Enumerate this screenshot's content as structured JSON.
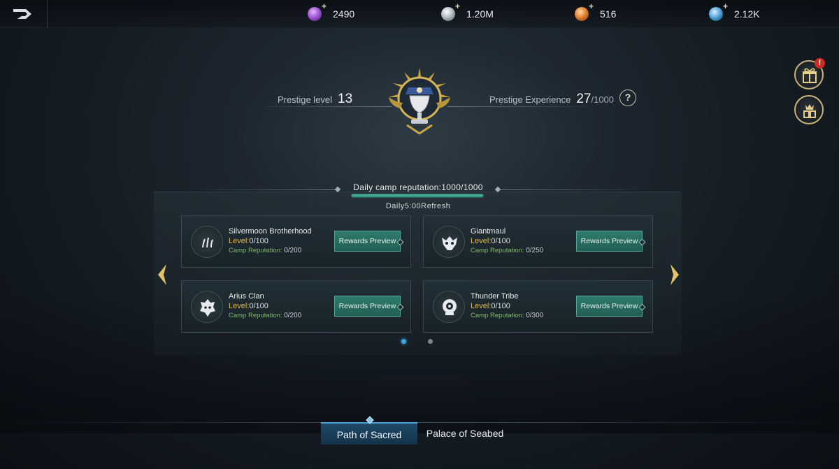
{
  "currencies": [
    {
      "name": "purple-gem-icon",
      "value": "2490",
      "color": "#9b4fd0"
    },
    {
      "name": "silver-coin-icon",
      "value": "1.20M",
      "color": "#b5bcc2"
    },
    {
      "name": "orange-orb-icon",
      "value": "516",
      "color": "#e07a2a"
    },
    {
      "name": "blue-orb-icon",
      "value": "2.12K",
      "color": "#4a9ed8"
    }
  ],
  "prestige": {
    "level_label": "Prestige level",
    "level_value": "13",
    "exp_label": "Prestige Experience",
    "exp_value": "27",
    "exp_max": "/1000",
    "help": "?"
  },
  "side_buttons": {
    "gift_badge": "!"
  },
  "reputation": {
    "text": "Daily camp reputation:1000/1000",
    "progress": 1.0,
    "refresh": "Daily5:00Refresh"
  },
  "camps": [
    {
      "name": "Silvermoon Brotherhood",
      "level_label": "Level:",
      "level": "0/100",
      "rep_label": "Camp Reputation:",
      "rep": "0/200",
      "button": "Rewards Preview",
      "icon": "claw-marks-icon"
    },
    {
      "name": "Giantmaul",
      "level_label": "Level:",
      "level": "0/100",
      "rep_label": "Camp Reputation:",
      "rep": "0/250",
      "button": "Rewards Preview",
      "icon": "beast-skull-icon"
    },
    {
      "name": "Arius Clan",
      "level_label": "Level:",
      "level": "0/100",
      "rep_label": "Camp Reputation:",
      "rep": "0/200",
      "button": "Rewards Preview",
      "icon": "demon-mask-icon"
    },
    {
      "name": "Thunder Tribe",
      "level_label": "Level:",
      "level": "0/100",
      "rep_label": "Camp Reputation:",
      "rep": "0/300",
      "button": "Rewards Preview",
      "icon": "eye-totem-icon"
    }
  ],
  "pagination": {
    "active_index": 0,
    "total": 2
  },
  "tabs": [
    {
      "label": "Path of Sacred",
      "active": true
    },
    {
      "label": "Palace of Seabed",
      "active": false
    }
  ],
  "colors": {
    "accent_teal": "#2f7a6e",
    "level_gold": "#e0b84a",
    "rep_green": "#7fb86a",
    "tab_active": "#1e4a6a"
  }
}
